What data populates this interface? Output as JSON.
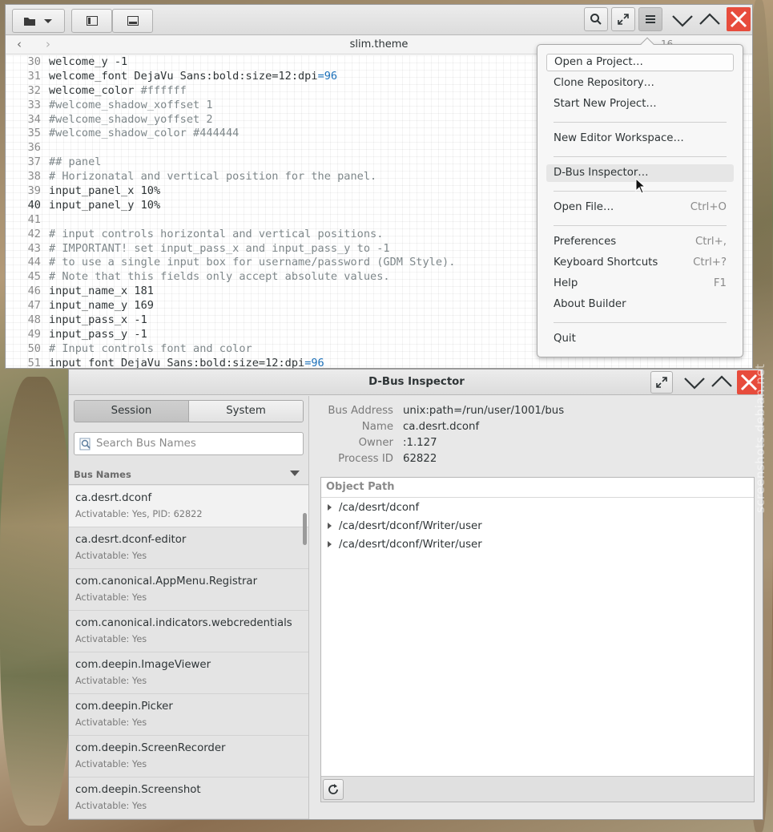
{
  "builder": {
    "file_title": "slim.theme",
    "line_col_partial": "16",
    "lines": [
      {
        "n": "30",
        "segs": [
          {
            "t": "welcome_y -1",
            "c": ""
          }
        ]
      },
      {
        "n": "31",
        "segs": [
          {
            "t": "welcome_font DejaVu Sans:bold:size=12:dpi",
            "c": ""
          },
          {
            "t": "=96",
            "c": "num"
          }
        ]
      },
      {
        "n": "32",
        "segs": [
          {
            "t": "welcome_color ",
            "c": ""
          },
          {
            "t": "#ffffff",
            "c": "cm"
          }
        ]
      },
      {
        "n": "33",
        "segs": [
          {
            "t": "#welcome_shadow_xoffset 1",
            "c": "cm"
          }
        ]
      },
      {
        "n": "34",
        "segs": [
          {
            "t": "#welcome_shadow_yoffset 2",
            "c": "cm"
          }
        ]
      },
      {
        "n": "35",
        "segs": [
          {
            "t": "#welcome_shadow_color #444444",
            "c": "cm"
          }
        ]
      },
      {
        "n": "36",
        "segs": []
      },
      {
        "n": "37",
        "segs": [
          {
            "t": "## panel",
            "c": "cm"
          }
        ]
      },
      {
        "n": "38",
        "segs": [
          {
            "t": "# Horizonatal and vertical position for the panel.",
            "c": "cm"
          }
        ]
      },
      {
        "n": "39",
        "segs": [
          {
            "t": "input_panel_x 10%",
            "c": ""
          }
        ]
      },
      {
        "n": "40",
        "segs": [
          {
            "t": "input_panel_y 10%",
            "c": ""
          }
        ],
        "current": true
      },
      {
        "n": "41",
        "segs": []
      },
      {
        "n": "42",
        "segs": [
          {
            "t": "# input controls horizontal and vertical positions.",
            "c": "cm"
          }
        ]
      },
      {
        "n": "43",
        "segs": [
          {
            "t": "# IMPORTANT! set input_pass_x and input_pass_y to -1",
            "c": "cm"
          }
        ]
      },
      {
        "n": "44",
        "segs": [
          {
            "t": "# to use a single input box for username/password (GDM Style).",
            "c": "cm"
          }
        ]
      },
      {
        "n": "45",
        "segs": [
          {
            "t": "# Note that this fields only accept absolute values.",
            "c": "cm"
          }
        ]
      },
      {
        "n": "46",
        "segs": [
          {
            "t": "input_name_x 181",
            "c": ""
          }
        ]
      },
      {
        "n": "47",
        "segs": [
          {
            "t": "input_name_y 169",
            "c": ""
          }
        ]
      },
      {
        "n": "48",
        "segs": [
          {
            "t": "input_pass_x -1",
            "c": ""
          }
        ]
      },
      {
        "n": "49",
        "segs": [
          {
            "t": "input_pass_y -1",
            "c": ""
          }
        ]
      },
      {
        "n": "50",
        "segs": [
          {
            "t": "# Input controls font and color",
            "c": "cm"
          }
        ]
      },
      {
        "n": "51",
        "segs": [
          {
            "t": "input_font DejaVu Sans:bold:size=12:dpi",
            "c": ""
          },
          {
            "t": "=96",
            "c": "num"
          }
        ]
      }
    ]
  },
  "menu": {
    "items": [
      {
        "label": "Open a Project…",
        "accel": "",
        "state": "focus"
      },
      {
        "label": "Clone Repository…",
        "accel": "",
        "state": ""
      },
      {
        "label": "Start New Project…",
        "accel": "",
        "state": ""
      },
      {
        "label": "New Editor Workspace…",
        "accel": "",
        "state": ""
      },
      {
        "label": "D-Bus Inspector…",
        "accel": "",
        "state": "hover"
      },
      {
        "label": "Open File…",
        "accel": "Ctrl+O",
        "state": ""
      },
      {
        "label": "Preferences",
        "accel": "Ctrl+,",
        "state": ""
      },
      {
        "label": "Keyboard Shortcuts",
        "accel": "Ctrl+?",
        "state": ""
      },
      {
        "label": "Help",
        "accel": "F1",
        "state": ""
      },
      {
        "label": "About Builder",
        "accel": "",
        "state": ""
      },
      {
        "label": "Quit",
        "accel": "",
        "state": ""
      }
    ]
  },
  "dbus": {
    "title": "D-Bus Inspector",
    "tabs": {
      "session": "Session",
      "system": "System"
    },
    "search_placeholder": "Search Bus Names",
    "column_header": "Bus Names",
    "bus_names": [
      {
        "name": "ca.desrt.dconf",
        "detail": "Activatable: Yes, PID: 62822"
      },
      {
        "name": "ca.desrt.dconf-editor",
        "detail": "Activatable: Yes"
      },
      {
        "name": "com.canonical.AppMenu.Registrar",
        "detail": "Activatable: Yes"
      },
      {
        "name": "com.canonical.indicators.webcredentials",
        "detail": "Activatable: Yes"
      },
      {
        "name": "com.deepin.ImageViewer",
        "detail": "Activatable: Yes"
      },
      {
        "name": "com.deepin.Picker",
        "detail": "Activatable: Yes"
      },
      {
        "name": "com.deepin.ScreenRecorder",
        "detail": "Activatable: Yes"
      },
      {
        "name": "com.deepin.Screenshot",
        "detail": "Activatable: Yes"
      }
    ],
    "info": {
      "bus_address_label": "Bus Address",
      "bus_address": "unix:path=/run/user/1001/bus",
      "name_label": "Name",
      "name": "ca.desrt.dconf",
      "owner_label": "Owner",
      "owner": ":1.127",
      "pid_label": "Process ID",
      "pid": "62822"
    },
    "object_path_header": "Object Path",
    "object_paths": [
      "/ca/desrt/dconf",
      "/ca/desrt/dconf/Writer/user",
      "/ca/desrt/dconf/Writer/user"
    ]
  },
  "watermark": "screenshots.debian.net",
  "colors": {
    "close_red": "#e74c3c",
    "accent_blue": "#1a6fb8"
  }
}
